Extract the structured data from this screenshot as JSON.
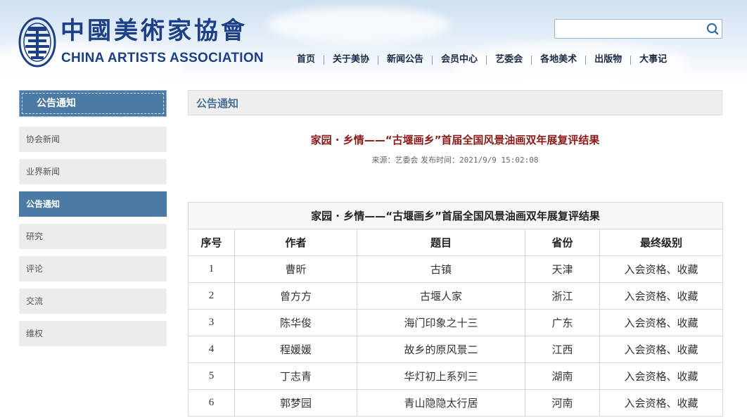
{
  "header": {
    "logo_cn": "中國美術家協會",
    "logo_en": "CHINA ARTISTS ASSOCIATION",
    "search": {
      "value": "",
      "placeholder": ""
    },
    "nav": [
      "首页",
      "关于美协",
      "新闻公告",
      "会员中心",
      "艺委会",
      "各地美术",
      "出版物",
      "大事记"
    ]
  },
  "sidebar": {
    "title": "公告通知",
    "items": [
      {
        "label": "协会新闻",
        "active": false
      },
      {
        "label": "业界新闻",
        "active": false
      },
      {
        "label": "公告通知",
        "active": true
      },
      {
        "label": "研究",
        "active": false
      },
      {
        "label": "评论",
        "active": false
      },
      {
        "label": "交流",
        "active": false
      },
      {
        "label": "维权",
        "active": false
      }
    ]
  },
  "main": {
    "section_title": "公告通知",
    "article": {
      "title": "家园 · 乡情——“古堰画乡”首届全国风景油画双年展复评结果",
      "source_label": "来源：艺委会",
      "time_label": "发布时间：",
      "time_value": "2021/9/9 15:02:08"
    },
    "table": {
      "caption": "家园 · 乡情——“古堰画乡”首届全国风景油画双年展复评结果",
      "headers": [
        "序号",
        "作者",
        "题目",
        "省份",
        "最终级别"
      ],
      "rows": [
        [
          "1",
          "曹昕",
          "古镇",
          "天津",
          "入会资格、收藏"
        ],
        [
          "2",
          "曾方方",
          "古堰人家",
          "浙江",
          "入会资格、收藏"
        ],
        [
          "3",
          "陈华俊",
          "海门印象之十三",
          "广东",
          "入会资格、收藏"
        ],
        [
          "4",
          "程媛媛",
          "故乡的原风景二",
          "江西",
          "入会资格、收藏"
        ],
        [
          "5",
          "丁志青",
          "华灯初上系列三",
          "湖南",
          "入会资格、收藏"
        ],
        [
          "6",
          "郭梦园",
          "青山隐隐太行居",
          "河南",
          "入会资格、收藏"
        ]
      ]
    }
  },
  "colors": {
    "brand_blue": "#1c3f86",
    "sidebar_active": "#4b7aa4",
    "title_red": "#8b1b1b"
  }
}
